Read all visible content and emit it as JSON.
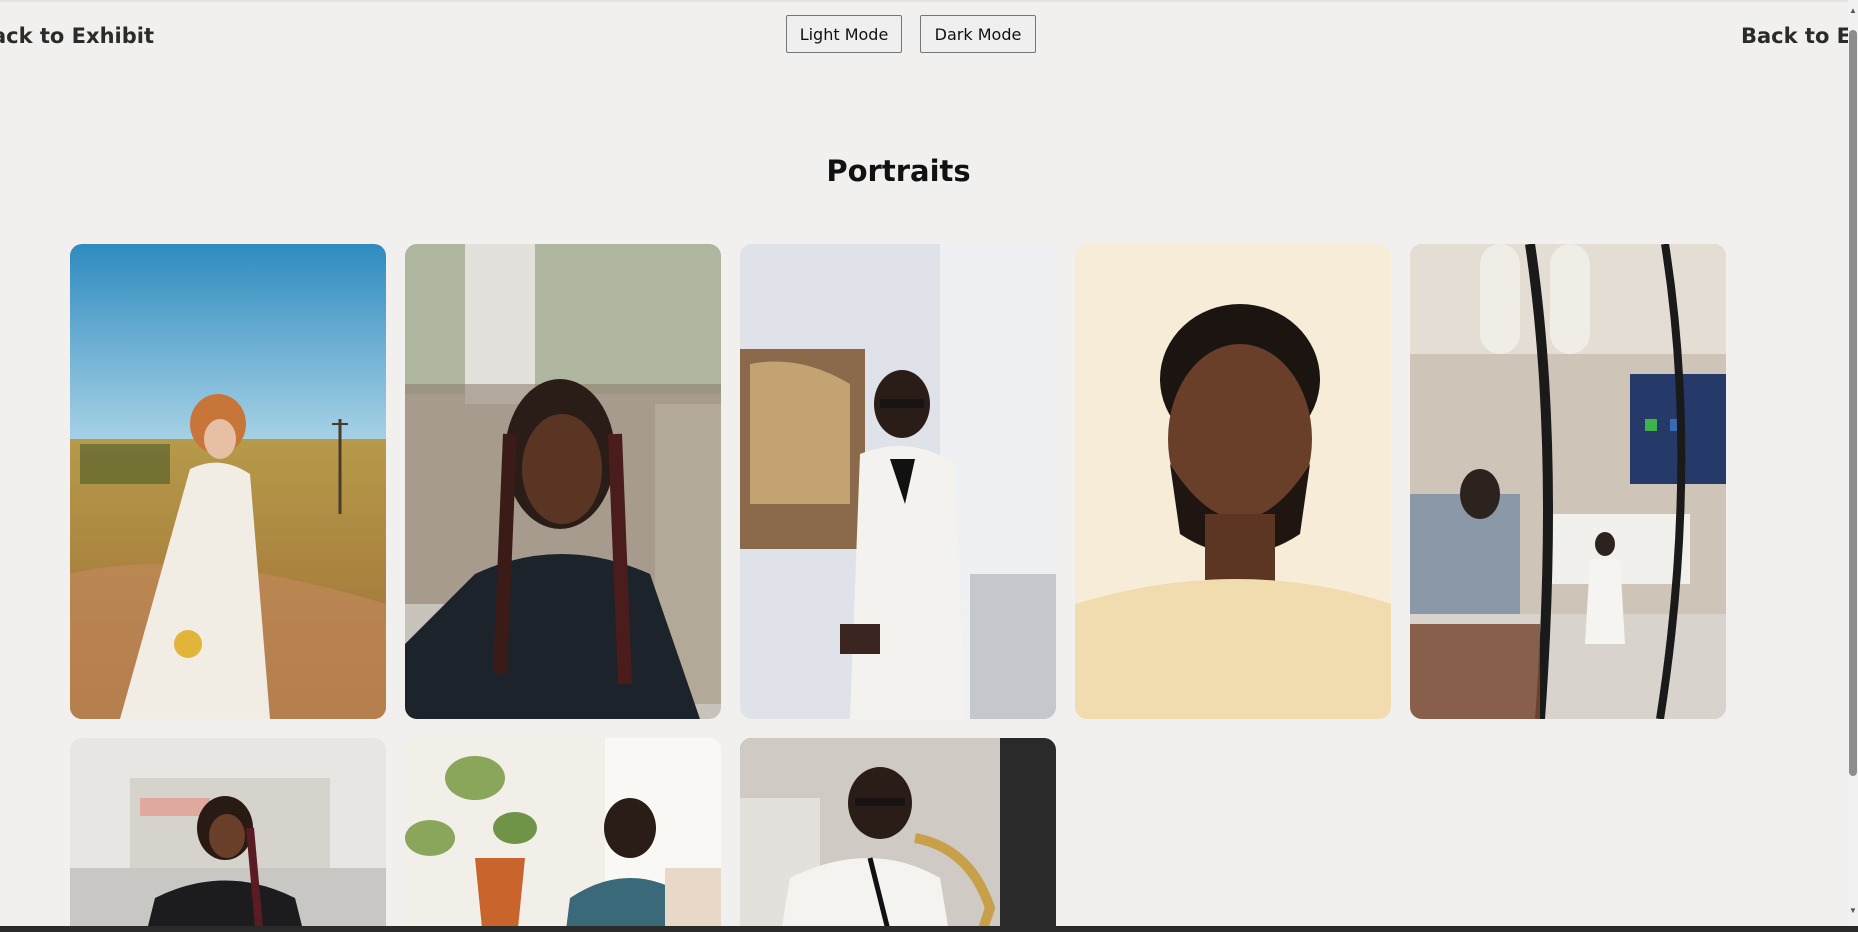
{
  "nav": {
    "back_left": "ack to Exhibit",
    "back_right": "Back to Exhibit"
  },
  "theme_buttons": {
    "light": "Light Mode",
    "dark": "Dark Mode"
  },
  "page": {
    "title": "Portraits"
  },
  "photos": [
    {
      "subject": "Woman in white dress holding flowers in a prairie field"
    },
    {
      "subject": "Woman with braids in black sweater"
    },
    {
      "subject": "Man in white tuxedo jacket on staircase"
    },
    {
      "subject": "Close-up of man with beard in cream t-shirt"
    },
    {
      "subject": "Living room reflected through mirror shapes"
    },
    {
      "subject": "Woman in leather jacket on street"
    },
    {
      "subject": "Man in blue suit beside potted plant"
    },
    {
      "subject": "Man playing saxophone"
    }
  ],
  "colors": {
    "background": "#f1f0ee",
    "text": "#222222"
  }
}
